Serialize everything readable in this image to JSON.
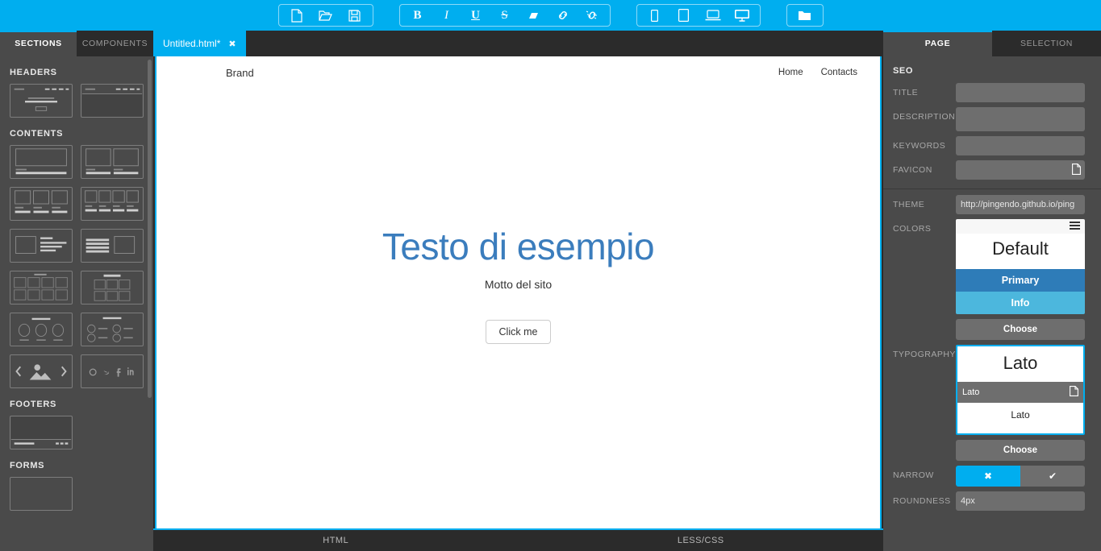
{
  "toolbar": {
    "groups": [
      {
        "name": "file-group",
        "buttons": [
          {
            "icon": "new-file-icon",
            "label": "New"
          },
          {
            "icon": "open-folder-icon",
            "label": "Open"
          },
          {
            "icon": "save-icon",
            "label": "Save"
          }
        ]
      },
      {
        "name": "format-group",
        "buttons": [
          {
            "icon": "bold-icon",
            "label": "B"
          },
          {
            "icon": "italic-icon",
            "label": "I"
          },
          {
            "icon": "underline-icon",
            "label": "U"
          },
          {
            "icon": "strikethrough-icon",
            "label": "S"
          },
          {
            "icon": "eraser-icon",
            "label": "Clear formatting"
          },
          {
            "icon": "link-icon",
            "label": "Link"
          },
          {
            "icon": "unlink-icon",
            "label": "Unlink"
          }
        ]
      },
      {
        "name": "viewport-group",
        "buttons": [
          {
            "icon": "phone-icon",
            "label": "Phone"
          },
          {
            "icon": "tablet-icon",
            "label": "Tablet"
          },
          {
            "icon": "laptop-icon",
            "label": "Laptop"
          },
          {
            "icon": "desktop-icon",
            "label": "Desktop"
          }
        ]
      },
      {
        "name": "assets-group",
        "buttons": [
          {
            "icon": "folder-icon",
            "label": "Assets"
          }
        ]
      }
    ]
  },
  "sidebar": {
    "tabs": [
      {
        "label": "SECTIONS",
        "active": true
      },
      {
        "label": "COMPONENTS",
        "active": false
      }
    ],
    "groups": [
      {
        "title": "HEADERS",
        "count": 2
      },
      {
        "title": "CONTENTS",
        "count": 10
      },
      {
        "title": "FOOTERS",
        "count": 1
      },
      {
        "title": "FORMS",
        "count": 1
      }
    ]
  },
  "editor": {
    "tab": {
      "title": "Untitled.html*",
      "close": "✖"
    },
    "page": {
      "brand": "Brand",
      "nav_links": [
        "Home",
        "Contacts"
      ],
      "heading": "Testo di esempio",
      "motto": "Motto del sito",
      "button": "Click me"
    },
    "code_tabs": [
      {
        "label": "HTML"
      },
      {
        "label": "LESS/CSS"
      }
    ]
  },
  "inspector": {
    "tabs": [
      {
        "label": "PAGE",
        "active": true
      },
      {
        "label": "SELECTION",
        "active": false
      }
    ],
    "seo": {
      "title": "SEO",
      "fields": [
        {
          "label": "TITLE",
          "value": "",
          "placeholder": ""
        },
        {
          "label": "DESCRIPTION",
          "value": "",
          "placeholder": ""
        },
        {
          "label": "KEYWORDS",
          "value": "",
          "placeholder": ""
        },
        {
          "label": "FAVICON",
          "value": "",
          "placeholder": "",
          "icon": "file-icon"
        }
      ]
    },
    "theme": {
      "label": "THEME",
      "value": "http://pingendo.github.io/ping"
    },
    "colors": {
      "label": "COLORS",
      "menu_icon": "hamburger-icon",
      "name": "Default",
      "bands": [
        {
          "label": "Primary",
          "color": "#2e7cb8"
        },
        {
          "label": "Info",
          "color": "#4cb7dd"
        }
      ],
      "choose_label": "Choose"
    },
    "typography": {
      "label": "TYPOGRAPHY",
      "name": "Lato",
      "selected": "Lato",
      "selected_icon": "file-icon",
      "body": "Lato",
      "choose_label": "Choose"
    },
    "narrow": {
      "label": "NARROW",
      "off_label": "✖",
      "on_label": "✔",
      "selected": "off"
    },
    "roundness": {
      "label": "ROUNDNESS",
      "value": "4px"
    }
  },
  "colors": {
    "accent": "#00aeef",
    "panel": "#4a4a4a",
    "panel_dark": "#2b2b2b",
    "field": "#6e6e6e",
    "heading": "#3b7dbd"
  }
}
